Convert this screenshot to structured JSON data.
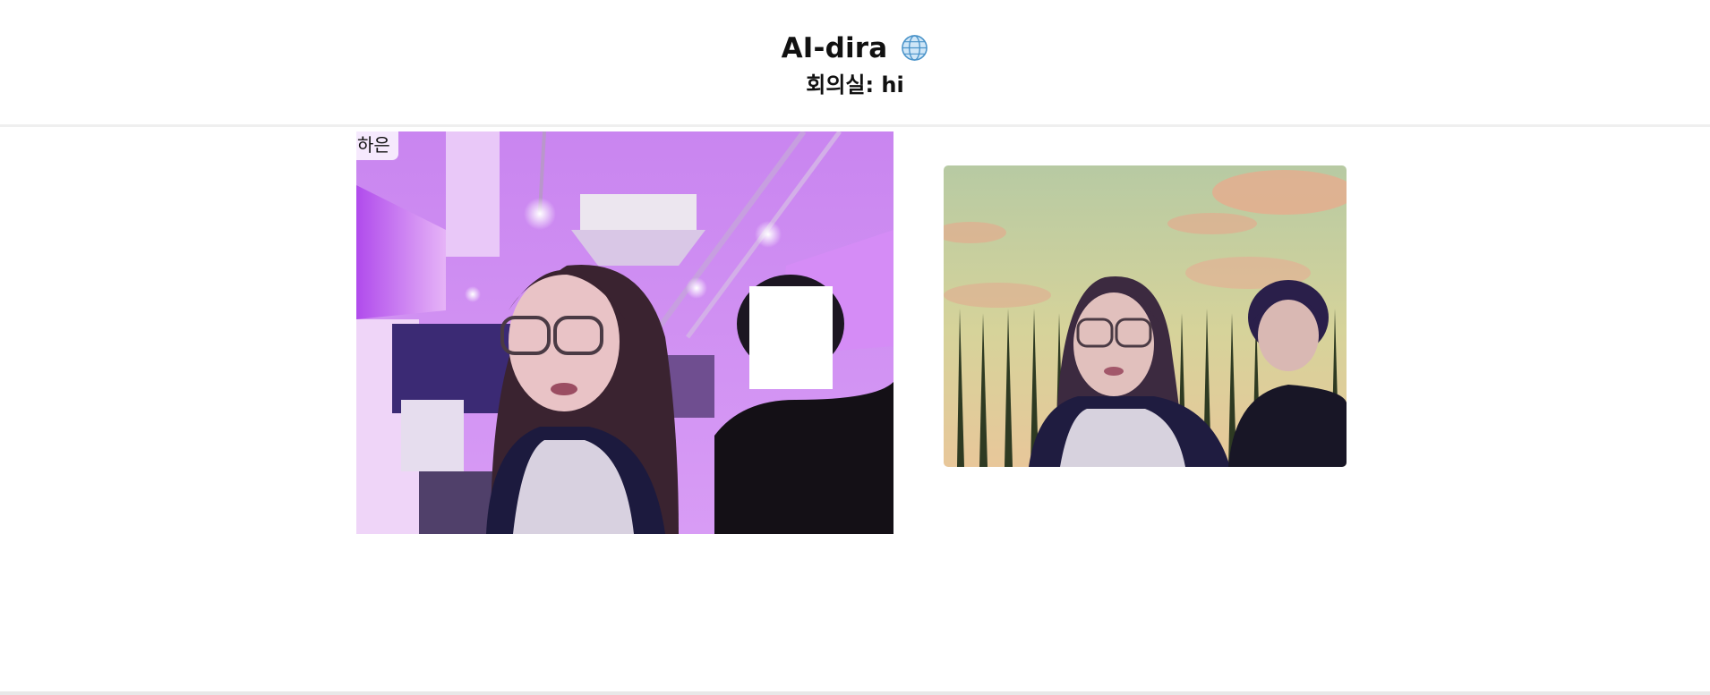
{
  "header": {
    "app_title": "AI-dira",
    "icon": "globe-icon",
    "room_label": "회의실: hi"
  },
  "videos": {
    "local": {
      "participant_name": "하은"
    },
    "remote": {
      "participant_name": ""
    }
  },
  "colors": {
    "header_border": "#efefef",
    "text": "#111111",
    "local_tint": "#b64de8",
    "remote_sky": "#c7cf9c"
  }
}
